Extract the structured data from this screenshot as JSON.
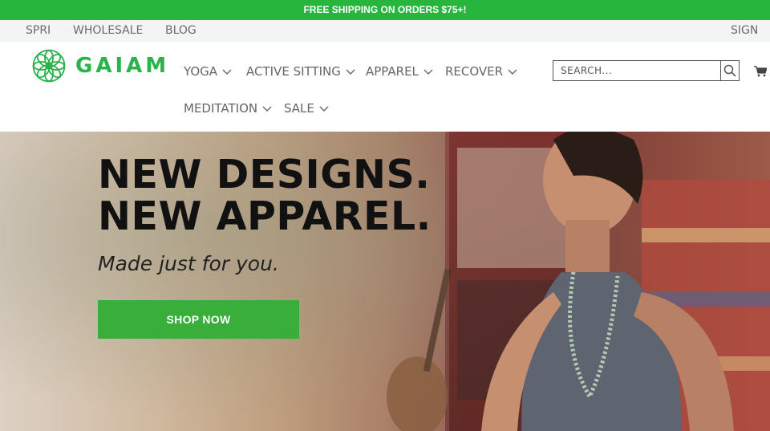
{
  "promo": {
    "text": "FREE SHIPPING ON ORDERS $75+!"
  },
  "utility": {
    "links": [
      "SPRI",
      "WHOLESALE",
      "BLOG"
    ],
    "sign_in": "SIGN IN"
  },
  "brand": {
    "logo_text": "GAIAM",
    "color": "#2ab24b"
  },
  "nav": {
    "items": [
      {
        "label": "YOGA"
      },
      {
        "label": "ACTIVE SITTING"
      },
      {
        "label": "APPAREL"
      },
      {
        "label": "RECOVER"
      },
      {
        "label": "MEDITATION"
      },
      {
        "label": "SALE"
      }
    ]
  },
  "search": {
    "placeholder": "SEARCH...",
    "icon": "search-icon"
  },
  "cart": {
    "icon": "cart-icon"
  },
  "hero": {
    "headline_line1": "NEW DESIGNS.",
    "headline_line2": "NEW APPAREL.",
    "tagline": "Made just for you.",
    "cta_label": "SHOP NOW",
    "cta_color": "#3aae3a"
  },
  "colors": {
    "promo_bg": "#28b53d",
    "util_bg": "#f2f4f6"
  }
}
